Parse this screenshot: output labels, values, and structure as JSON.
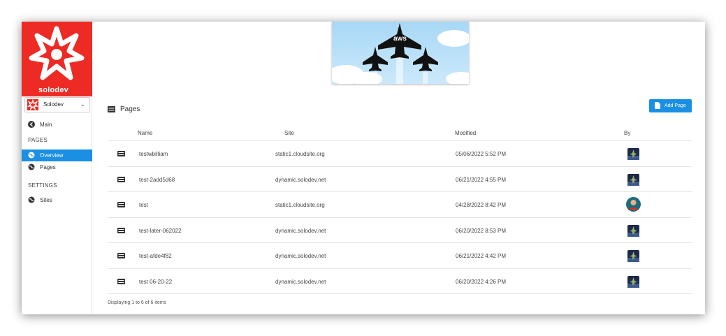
{
  "sidebar": {
    "brand": "solodev",
    "site_select": {
      "value": "Solodev"
    },
    "main_label": "Main",
    "pages_heading": "PAGES",
    "overview_label": "Overview",
    "pages_label": "Pages",
    "settings_heading": "SETTINGS",
    "sites_label": "Sites"
  },
  "banner": {
    "text": "aws"
  },
  "main": {
    "title": "Pages",
    "add_button": "Add Page",
    "columns": {
      "name": "Name",
      "site": "Site",
      "modified": "Modified",
      "by": "By"
    },
    "rows": [
      {
        "name": "testwbilliam",
        "site": "static1.cloudsite.org",
        "modified": "05/06/2022 5:52 PM",
        "avatar": "jet"
      },
      {
        "name": "test-2add5d68",
        "site": "dynamic.solodev.net",
        "modified": "06/21/2022 4:55 PM",
        "avatar": "jet"
      },
      {
        "name": "test",
        "site": "static1.cloudsite.org",
        "modified": "04/28/2022 8:42 PM",
        "avatar": "person"
      },
      {
        "name": "test-later-062022",
        "site": "dynamic.solodev.net",
        "modified": "06/20/2022 8:53 PM",
        "avatar": "jet"
      },
      {
        "name": "test-afde4f82",
        "site": "dynamic.solodev.net",
        "modified": "06/21/2022 4:42 PM",
        "avatar": "jet"
      },
      {
        "name": "test 06-20-22",
        "site": "dynamic.solodev.net",
        "modified": "06/20/2022 4:26 PM",
        "avatar": "jet"
      }
    ],
    "footer": "Displaying 1 to 6 of 6 items"
  },
  "colors": {
    "brand_red": "#ee2a24",
    "accent_blue": "#1a8fe3"
  }
}
